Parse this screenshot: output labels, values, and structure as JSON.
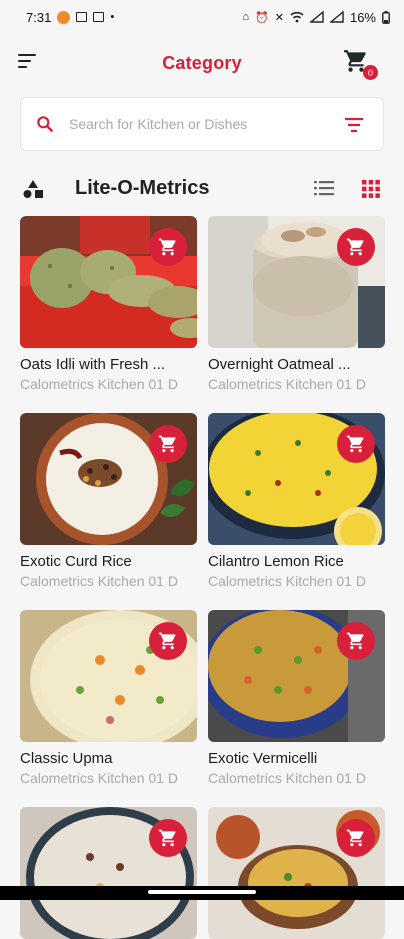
{
  "status": {
    "time": "7:31",
    "battery": "16%"
  },
  "appbar": {
    "title": "Category",
    "cart_count": "0"
  },
  "search": {
    "placeholder": "Search for Kitchen or Dishes"
  },
  "section": {
    "title": "Lite-O-Metrics"
  },
  "icons": {
    "menu": "menu-icon",
    "cart": "cart-icon",
    "search": "search-icon",
    "filter": "filter-icon",
    "category": "shapes-icon",
    "list_view": "list-view-icon",
    "grid_view": "grid-view-icon",
    "add_to_cart": "cart-icon"
  },
  "colors": {
    "accent": "#d81f3a",
    "text": "#1c1c1c",
    "muted": "#a9a9ad",
    "background": "#f6f6f7"
  },
  "items": [
    {
      "name": "Oats Idli with Fresh ...",
      "kitchen": "Calometrics Kitchen 01 D"
    },
    {
      "name": "Overnight Oatmeal ...",
      "kitchen": "Calometrics Kitchen 01 D"
    },
    {
      "name": "Exotic Curd Rice",
      "kitchen": "Calometrics Kitchen 01 D"
    },
    {
      "name": "Cilantro Lemon Rice",
      "kitchen": "Calometrics Kitchen 01 D"
    },
    {
      "name": "Classic Upma",
      "kitchen": "Calometrics Kitchen 01 D"
    },
    {
      "name": "Exotic Vermicelli",
      "kitchen": "Calometrics Kitchen 01 D"
    },
    {
      "name": "",
      "kitchen": ""
    },
    {
      "name": "",
      "kitchen": ""
    }
  ]
}
